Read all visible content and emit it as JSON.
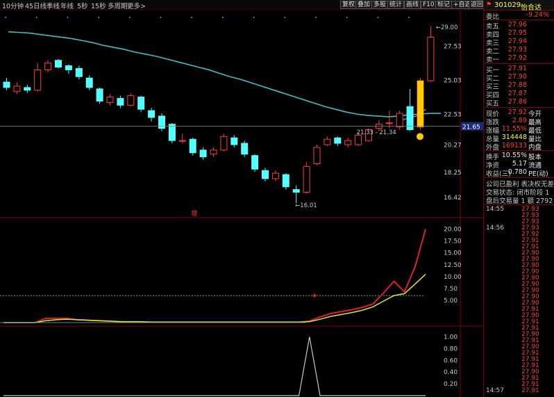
{
  "toolbar": {
    "timeframes": [
      "10分钟",
      "45日线",
      "季线",
      "年线",
      "5秒",
      "15秒",
      "多周期",
      "更多>"
    ],
    "buttons": [
      "复权",
      "叠加",
      "多股",
      "统计",
      "画线",
      "F10",
      "标记",
      "+自选",
      "返回"
    ]
  },
  "header": {
    "code": "301029",
    "name": "怡合达"
  },
  "quote": {
    "webi_label": "委比",
    "webi": "-9.24%",
    "asks": [
      {
        "label": "卖五",
        "price": "27.96"
      },
      {
        "label": "卖四",
        "price": "27.95"
      },
      {
        "label": "卖三",
        "price": "27.94"
      },
      {
        "label": "卖二",
        "price": "27.93"
      },
      {
        "label": "卖一",
        "price": "27.92"
      }
    ],
    "bids": [
      {
        "label": "买一",
        "price": "27.91"
      },
      {
        "label": "买二",
        "price": "27.90"
      },
      {
        "label": "买三",
        "price": "27.88"
      },
      {
        "label": "买四",
        "price": "27.87"
      },
      {
        "label": "买五",
        "price": "27.86"
      }
    ],
    "stats": [
      {
        "label": "现价",
        "value": "27.92",
        "extra": "今开",
        "color": "red"
      },
      {
        "label": "涨跌",
        "value": "2.89",
        "extra": "最高",
        "color": "red"
      },
      {
        "label": "涨幅",
        "value": "11.55%",
        "extra": "最低",
        "color": "red"
      },
      {
        "label": "总量",
        "value": "314448",
        "extra": "量比",
        "color": "yellow"
      },
      {
        "label": "外盘",
        "value": "169133",
        "extra": "内盘",
        "color": "red"
      },
      {
        "label": "换手",
        "value": "10.55%",
        "extra": "股本",
        "color": "white"
      },
      {
        "label": "净资",
        "value": "5.17",
        "extra": "流通",
        "color": "white"
      },
      {
        "label": "收益(三)",
        "value": "0.780",
        "extra": "PE(动)",
        "color": "white"
      }
    ],
    "notes": [
      "公司已盈利 表决权无差异",
      "交易状态: 闭市阶段 1",
      "盘后交易量 1 额 2792"
    ],
    "ticks": [
      {
        "time": "14:55",
        "price": "27.93"
      },
      {
        "time": "",
        "price": "27.93"
      },
      {
        "time": "",
        "price": "27.93"
      },
      {
        "time": "14:56",
        "price": "27.93"
      },
      {
        "time": "",
        "price": "27.92"
      },
      {
        "time": "",
        "price": "27.91"
      },
      {
        "time": "",
        "price": "27.91"
      },
      {
        "time": "",
        "price": "27.90"
      },
      {
        "time": "",
        "price": "27.90"
      },
      {
        "time": "",
        "price": "27.90"
      },
      {
        "time": "",
        "price": "27.90"
      },
      {
        "time": "",
        "price": "27.90"
      },
      {
        "time": "",
        "price": "27.90"
      },
      {
        "time": "",
        "price": "27.90"
      },
      {
        "time": "",
        "price": "27.90"
      },
      {
        "time": "",
        "price": "27.90"
      },
      {
        "time": "",
        "price": "27.91"
      },
      {
        "time": "",
        "price": "27.90"
      },
      {
        "time": "",
        "price": "27.91"
      },
      {
        "time": "",
        "price": "27.91"
      },
      {
        "time": "",
        "price": "27.90"
      },
      {
        "time": "",
        "price": "27.91"
      },
      {
        "time": "",
        "price": "27.90"
      },
      {
        "time": "",
        "price": "27.91"
      },
      {
        "time": "",
        "price": "27.91"
      },
      {
        "time": "",
        "price": "27.91"
      },
      {
        "time": "",
        "price": "27.90"
      },
      {
        "time": "",
        "price": "27.91"
      },
      {
        "time": "",
        "price": "27.91"
      },
      {
        "time": "14:57",
        "price": "27.91"
      }
    ]
  },
  "chart_data": [
    {
      "type": "candlestick",
      "y_ticks": [
        "27.53",
        "25.03",
        "22.53",
        "20.27",
        "18.25",
        "16.42"
      ],
      "current_price_tag": "21.65",
      "annotations": {
        "high": "29.00",
        "low": "16.01",
        "range_label": "21.33 - 21.34",
        "marker": "增"
      },
      "candles": [
        {
          "o": 24.9,
          "c": 24.5,
          "h": 25.2,
          "l": 24.3
        },
        {
          "o": 24.2,
          "c": 24.6,
          "h": 24.9,
          "l": 24.0
        },
        {
          "o": 24.5,
          "c": 24.3,
          "h": 24.7,
          "l": 24.1
        },
        {
          "o": 24.3,
          "c": 25.8,
          "h": 26.3,
          "l": 24.2
        },
        {
          "o": 25.8,
          "c": 26.3,
          "h": 26.5,
          "l": 25.6
        },
        {
          "o": 26.5,
          "c": 26.0,
          "h": 26.6,
          "l": 25.9
        },
        {
          "o": 26.1,
          "c": 25.8,
          "h": 26.2,
          "l": 25.5
        },
        {
          "o": 25.9,
          "c": 25.3,
          "h": 26.1,
          "l": 25.1
        },
        {
          "o": 25.2,
          "c": 24.5,
          "h": 25.4,
          "l": 24.3
        },
        {
          "o": 24.4,
          "c": 23.5,
          "h": 24.5,
          "l": 23.3
        },
        {
          "o": 23.4,
          "c": 23.8,
          "h": 24.0,
          "l": 23.2
        },
        {
          "o": 23.7,
          "c": 23.2,
          "h": 23.9,
          "l": 23.0
        },
        {
          "o": 23.2,
          "c": 23.9,
          "h": 24.1,
          "l": 23.1
        },
        {
          "o": 23.8,
          "c": 22.9,
          "h": 23.9,
          "l": 22.7
        },
        {
          "o": 22.8,
          "c": 22.3,
          "h": 23.0,
          "l": 22.0
        },
        {
          "o": 22.4,
          "c": 21.5,
          "h": 22.6,
          "l": 21.3
        },
        {
          "o": 21.8,
          "c": 20.6,
          "h": 21.9,
          "l": 20.4
        },
        {
          "o": 20.6,
          "c": 20.6,
          "h": 21.1,
          "l": 20.4
        },
        {
          "o": 20.7,
          "c": 19.7,
          "h": 20.8,
          "l": 19.5
        },
        {
          "o": 19.9,
          "c": 19.4,
          "h": 20.1,
          "l": 19.2
        },
        {
          "o": 19.6,
          "c": 19.9,
          "h": 20.1,
          "l": 19.4
        },
        {
          "o": 19.9,
          "c": 20.9,
          "h": 21.1,
          "l": 19.8
        },
        {
          "o": 20.8,
          "c": 20.3,
          "h": 21.0,
          "l": 20.1
        },
        {
          "o": 20.4,
          "c": 19.6,
          "h": 20.6,
          "l": 19.4
        },
        {
          "o": 19.5,
          "c": 18.5,
          "h": 19.6,
          "l": 18.3
        },
        {
          "o": 18.4,
          "c": 17.8,
          "h": 18.6,
          "l": 17.6
        },
        {
          "o": 17.8,
          "c": 18.2,
          "h": 18.4,
          "l": 17.6
        },
        {
          "o": 18.1,
          "c": 17.2,
          "h": 18.2,
          "l": 17.0
        },
        {
          "o": 17.0,
          "c": 16.8,
          "h": 17.3,
          "l": 16.0
        },
        {
          "o": 16.8,
          "c": 18.7,
          "h": 19.0,
          "l": 16.7
        },
        {
          "o": 18.9,
          "c": 20.1,
          "h": 20.3,
          "l": 18.8
        },
        {
          "o": 20.3,
          "c": 20.7,
          "h": 20.9,
          "l": 20.2
        },
        {
          "o": 20.8,
          "c": 20.4,
          "h": 20.9,
          "l": 20.2
        },
        {
          "o": 20.3,
          "c": 20.6,
          "h": 20.8,
          "l": 20.1
        },
        {
          "o": 20.3,
          "c": 21.0,
          "h": 21.2,
          "l": 20.2
        },
        {
          "o": 20.6,
          "c": 21.4,
          "h": 21.5,
          "l": 20.5
        },
        {
          "o": 21.5,
          "c": 21.8,
          "h": 22.1,
          "l": 21.3
        },
        {
          "o": 21.9,
          "c": 21.9,
          "h": 22.8,
          "l": 21.5
        },
        {
          "o": 21.6,
          "c": 22.6,
          "h": 22.8,
          "l": 21.4
        },
        {
          "o": 23.1,
          "c": 21.4,
          "h": 24.4,
          "l": 21.3
        },
        {
          "o": 21.6,
          "c": 25.0,
          "h": 25.2,
          "l": 21.4
        },
        {
          "o": 25.0,
          "c": 28.2,
          "h": 29.0,
          "l": 24.9
        }
      ],
      "ma_line": [
        28.6,
        28.55,
        28.5,
        28.4,
        28.3,
        28.2,
        28.1,
        27.95,
        27.8,
        27.6,
        27.45,
        27.3,
        27.1,
        26.95,
        26.8,
        26.6,
        26.4,
        26.2,
        26.0,
        25.8,
        25.55,
        25.3,
        25.1,
        24.85,
        24.6,
        24.35,
        24.1,
        23.85,
        23.6,
        23.35,
        23.1,
        22.9,
        22.7,
        22.55,
        22.45,
        22.4,
        22.35,
        22.4,
        22.5,
        22.55,
        22.6,
        22.6
      ],
      "ma_short": [
        22.0,
        22.2,
        22.4,
        22.9
      ]
    },
    {
      "type": "line",
      "y_ticks": [
        "20.00",
        "17.50",
        "15.00",
        "12.50",
        "10.00",
        "7.50",
        "5.00"
      ],
      "ylim": [
        0,
        22
      ],
      "reference_level": 6.0,
      "series": [
        {
          "values": [
            0.3,
            0.3,
            0.3,
            0.3,
            1.2,
            1.2,
            1.2,
            0.9,
            0.8,
            0.7,
            0.6,
            0.5,
            0.4,
            0.4,
            0.4,
            0.4,
            0.4,
            0.4,
            0.4,
            0.4,
            0.4,
            0.4,
            0.4,
            0.4,
            0.4,
            0.4,
            0.4,
            0.4,
            0.4,
            0.6,
            1.5,
            2.2,
            2.6,
            3.0,
            3.5,
            4.2,
            6.5,
            9.0,
            6.8,
            12.0,
            20.0
          ]
        },
        {
          "values": [
            0.3,
            0.3,
            0.3,
            0.3,
            0.7,
            0.9,
            1.0,
            0.9,
            0.8,
            0.7,
            0.6,
            0.5,
            0.5,
            0.5,
            0.4,
            0.4,
            0.4,
            0.4,
            0.4,
            0.4,
            0.4,
            0.4,
            0.4,
            0.4,
            0.4,
            0.4,
            0.4,
            0.4,
            0.4,
            0.5,
            1.0,
            1.6,
            2.0,
            2.4,
            2.9,
            3.6,
            4.8,
            6.0,
            6.4,
            8.4,
            10.5
          ]
        }
      ]
    },
    {
      "type": "line",
      "y_ticks": [
        "1.00",
        "0.80",
        "0.60",
        "0.40",
        "0.20"
      ],
      "ylim": [
        0,
        1.1
      ],
      "series": [
        {
          "values": [
            0,
            0,
            0,
            0,
            0,
            0,
            0,
            0,
            0,
            0,
            0,
            0,
            0,
            0,
            0,
            0,
            0,
            0,
            0,
            0,
            0,
            0,
            0,
            0,
            0,
            0,
            0,
            0,
            0,
            1.0,
            0,
            0,
            0,
            0,
            0,
            0,
            0,
            0,
            0,
            0,
            0
          ]
        }
      ]
    }
  ]
}
